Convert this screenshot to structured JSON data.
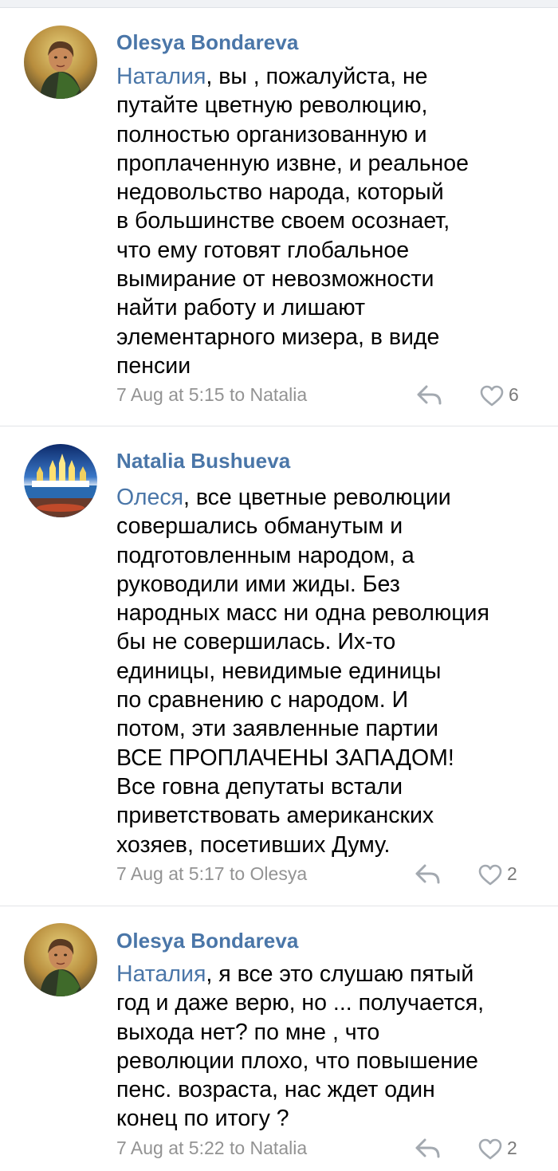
{
  "comments": [
    {
      "author": "Olesya Bondareva",
      "mention": "Наталия",
      "lines": [
        ", вы , пожалуйста, не",
        "путайте цветную революцию,",
        "полностью организованную и",
        "проплаченную извне, и реальное",
        "недовольство народа, который",
        "в большинстве своем осознает,",
        "что ему готовят глобальное",
        "вымирание от невозможности",
        "найти работу и лишают",
        "элементарного мизера, в виде",
        "пенсии"
      ],
      "meta": "7 Aug at 5:15 to Natalia",
      "likes": "6",
      "reply_icon": "reply-icon",
      "like_icon": "heart-icon"
    },
    {
      "author": "Natalia Bushueva",
      "mention": "Олеся",
      "lines": [
        ", все цветные революции",
        "совершались обманутым и",
        "подготовленным народом, а",
        "руководили ими жиды. Без",
        "народных масс ни одна революция",
        "бы не совершилась. Их-то",
        "единицы, невидимые единицы",
        "по сравнению с народом. И",
        "потом, эти заявленные партии",
        "ВСЕ ПРОПЛАЧЕНЫ ЗАПАДОМ!",
        "Все говна депутаты встали",
        "приветствовать американских",
        "хозяев, посетивших Думу."
      ],
      "meta": "7 Aug at 5:17 to Olesya",
      "likes": "2",
      "reply_icon": "reply-icon",
      "like_icon": "heart-icon"
    },
    {
      "author": "Olesya Bondareva",
      "mention": "Наталия",
      "lines": [
        ", я все это слушаю пятый",
        "год и даже верю, но ... получается,",
        "выхода нет? по мне , что",
        "революции плохо, что повышение",
        "пенс. возраста, нас ждет один",
        "конец по итогу ?"
      ],
      "meta": "7 Aug at 5:22 to Natalia",
      "likes": "2",
      "reply_icon": "reply-icon",
      "like_icon": "heart-icon"
    }
  ],
  "colors": {
    "link": "#4a76a8",
    "meta": "#939393",
    "divider": "#e2e4e7"
  }
}
